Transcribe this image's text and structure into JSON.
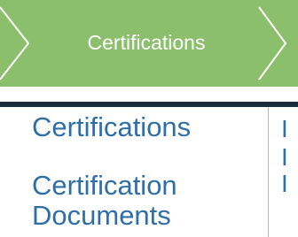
{
  "breadcrumb": {
    "active_step": "Certifications"
  },
  "sidebar": {
    "items": [
      {
        "label": "Certifications"
      },
      {
        "label": "Certification Documents"
      }
    ]
  },
  "content": {
    "clipped_fragments": [
      "I",
      "I",
      "I"
    ]
  },
  "colors": {
    "step_bar": "#8bbf6b",
    "step_text": "#ffffff",
    "divider": "#1c2e3e",
    "link": "#2f6fa8"
  }
}
